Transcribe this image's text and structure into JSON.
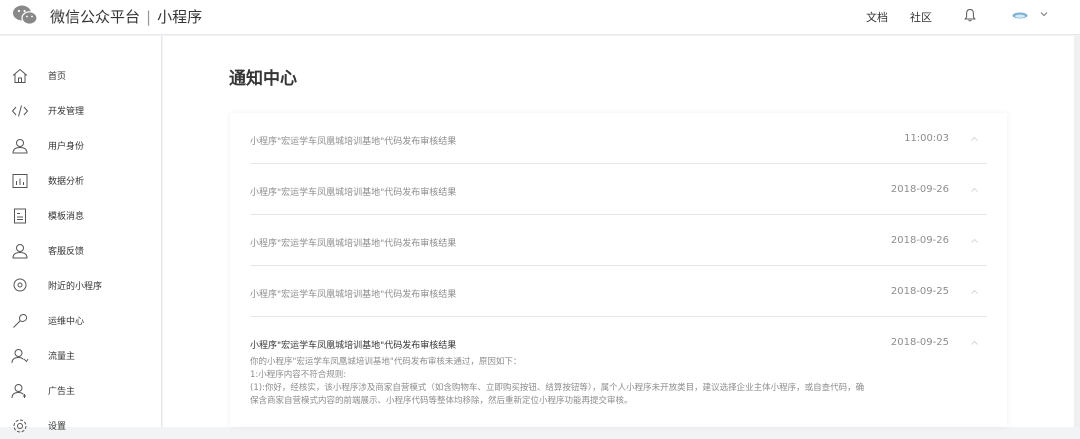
{
  "header": {
    "brand_name": "微信公众平台",
    "separator": "|",
    "product": "小程序",
    "nav": [
      "文档",
      "社区"
    ]
  },
  "sidebar": {
    "items": [
      {
        "label": "首页",
        "icon": "home-icon"
      },
      {
        "label": "开发管理",
        "icon": "code-icon"
      },
      {
        "label": "用户身份",
        "icon": "user-icon"
      },
      {
        "label": "数据分析",
        "icon": "chart-icon"
      },
      {
        "label": "模板消息",
        "icon": "template-icon"
      },
      {
        "label": "客服反馈",
        "icon": "user-feedback-icon"
      },
      {
        "label": "附近的小程序",
        "icon": "location-icon"
      },
      {
        "label": "运维中心",
        "icon": "wrench-icon"
      },
      {
        "label": "流量主",
        "icon": "traffic-user-icon"
      },
      {
        "label": "广告主",
        "icon": "advertiser-icon"
      },
      {
        "label": "设置",
        "icon": "gear-icon"
      }
    ]
  },
  "main": {
    "title": "通知中心",
    "notifications": [
      {
        "subject": "小程序\"宏运学车凤凰城培训基地\"代码发布审核结果",
        "date": "11:00:03"
      },
      {
        "subject": "小程序\"宏运学车凤凰城培训基地\"代码发布审核结果",
        "date": "2018-09-26"
      },
      {
        "subject": "小程序\"宏运学车凤凰城培训基地\"代码发布审核结果",
        "date": "2018-09-26"
      },
      {
        "subject": "小程序\"宏运学车凤凰城培训基地\"代码发布审核结果",
        "date": "2018-09-25"
      },
      {
        "subject": "小程序\"宏运学车凤凰城培训基地\"代码发布审核结果",
        "date": "2018-09-25"
      }
    ],
    "detail_lines": [
      "你的小程序\"宏运学车凤凰城培训基地\"代码发布审核未通过，原因如下：",
      "1:小程序内容不符合规则:",
      "(1):你好，经核实，该小程序涉及商家自营模式（如含购物车、立即购买按钮、结算按钮等），属个人小程序未开放类目，建议选择企业主体小程序，或自查代码，确",
      "保含商家自营模式内容的前端展示、小程序代码等整体均移除，然后重新定位小程序功能再提交审核。"
    ]
  },
  "colors": {
    "accent": "#1aad19",
    "text": "#353535",
    "muted": "#8d8d8d",
    "divider": "#e7e7eb"
  }
}
